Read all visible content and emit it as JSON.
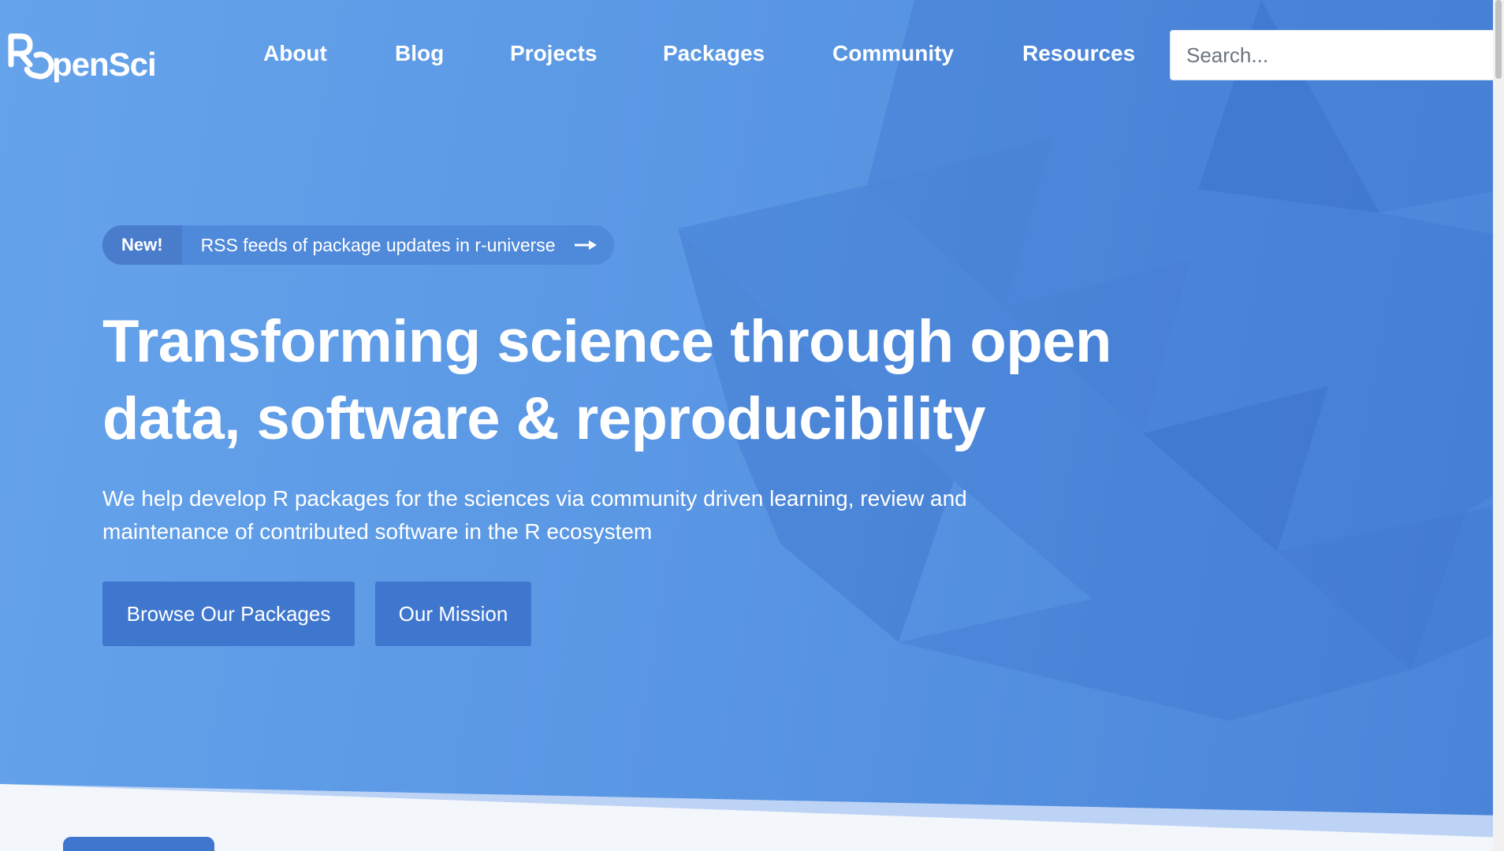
{
  "brand": {
    "logo_text": "ROpenSci",
    "colors": {
      "hero_blue": "#5a97e4",
      "button_blue": "#3f77cf",
      "text_white": "#ffffff"
    }
  },
  "nav": {
    "items": [
      {
        "label": "About"
      },
      {
        "label": "Blog"
      },
      {
        "label": "Projects"
      },
      {
        "label": "Packages"
      },
      {
        "label": "Community"
      },
      {
        "label": "Resources"
      }
    ]
  },
  "search": {
    "placeholder": "Search...",
    "value": ""
  },
  "announcement": {
    "badge": "New!",
    "text": "RSS feeds of package updates in r-universe",
    "icon": "arrow-right-icon"
  },
  "hero": {
    "headline": "Transforming science through open data, software & reproducibility",
    "subhead": "We help develop R packages for the sciences via community driven learning, review and maintenance of contributed software in the R ecosystem",
    "buttons": {
      "browse_label": "Browse Our Packages",
      "mission_label": "Our Mission"
    }
  }
}
